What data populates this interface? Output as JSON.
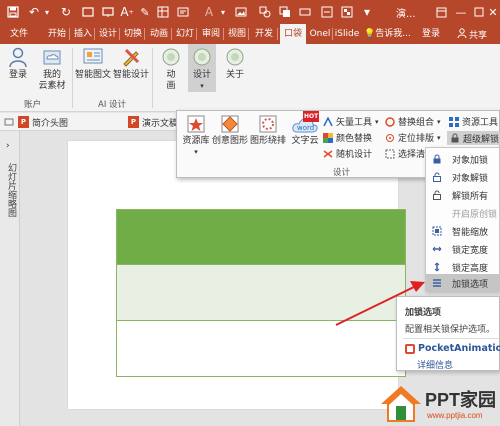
{
  "titlebar": {
    "title": "演..."
  },
  "tabs": [
    {
      "label": "文件"
    },
    {
      "label": "开始"
    },
    {
      "label": "插入"
    },
    {
      "label": "设计"
    },
    {
      "label": "切换"
    },
    {
      "label": "动画"
    },
    {
      "label": "幻灯"
    },
    {
      "label": "审阅"
    },
    {
      "label": "视图"
    },
    {
      "label": "开发"
    },
    {
      "label": "口袋"
    },
    {
      "label": "Onel"
    },
    {
      "label": "iSlide"
    }
  ],
  "tell_me": "告诉我...",
  "login": "登录",
  "share": "共享",
  "ribbon": {
    "login_btn": "登录",
    "my_cloud_line1": "我的",
    "my_cloud_line2": "云素材",
    "account_group": "账户",
    "smart_graphic": "智能图文",
    "smart_design": "智能设计",
    "ai_group": "AI 设计",
    "animation": "动",
    "animation2": "画",
    "design": "设计",
    "about": "关于"
  },
  "doc_tabs": [
    {
      "label": "简介头图"
    },
    {
      "label": "演示文稿"
    }
  ],
  "left_pane_label": "幻灯片缩略图",
  "gallery": {
    "resource_lib": "资源库",
    "creative_shapes": "创意图形",
    "shape_layout": "图形绕排",
    "word_cloud": "文字云",
    "vector_tools": "矢量工具",
    "color_replace": "颜色替换",
    "random_design": "随机设计",
    "replace_combine": "替换组合",
    "position_layout": "定位排版",
    "select_clear": "选择清",
    "resource_tools": "资源工具",
    "super_unlock": "超级解锁",
    "group_label": "设计",
    "hot_badge": "HOT",
    "word_badge": "word"
  },
  "dropdown": [
    {
      "label": "对象加锁",
      "icon": "lock-icon",
      "disabled": false,
      "highlighted": false
    },
    {
      "label": "对象解锁",
      "icon": "unlock-icon",
      "disabled": false,
      "highlighted": false
    },
    {
      "label": "解锁所有",
      "icon": "unlock-all-icon",
      "disabled": false,
      "highlighted": false
    },
    {
      "label": "开启原创锁",
      "icon": "",
      "disabled": true,
      "highlighted": false
    },
    {
      "label": "智能缩放",
      "icon": "smart-scale-icon",
      "disabled": false,
      "highlighted": false
    },
    {
      "label": "锁定宽度",
      "icon": "lock-width-icon",
      "disabled": false,
      "highlighted": false
    },
    {
      "label": "锁定高度",
      "icon": "lock-height-icon",
      "disabled": false,
      "highlighted": false
    },
    {
      "label": "加锁选项",
      "icon": "lock-options-icon",
      "disabled": false,
      "highlighted": true
    }
  ],
  "tooltip": {
    "title": "加锁选项",
    "description": "配置相关锁保护选项。",
    "brand": "PocketAnimation",
    "more": "详细信息"
  },
  "watermark": {
    "text": "PPT家园",
    "url": "www.pptjia.com"
  },
  "colors": {
    "accent": "#b7472a",
    "slide_green": "#70ad47",
    "slide_light": "#e8efe3",
    "arrow": "#e02020"
  }
}
